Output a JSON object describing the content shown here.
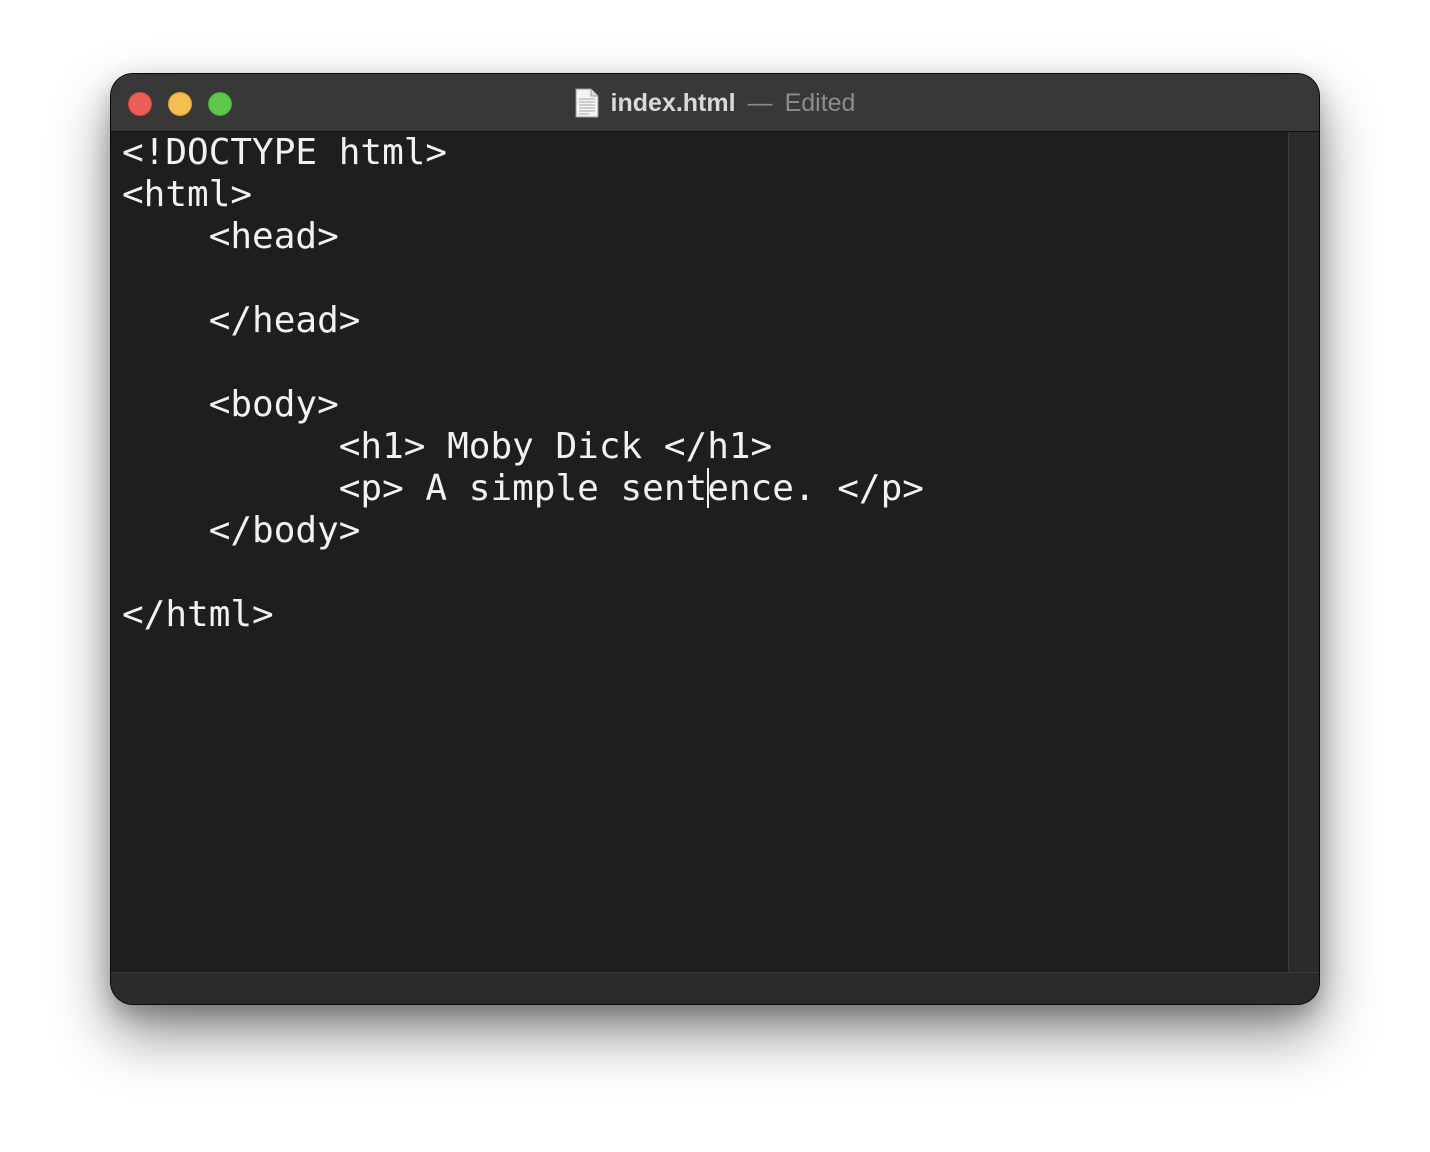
{
  "window": {
    "filename": "index.html",
    "separator": "—",
    "status": "Edited"
  },
  "editor": {
    "lines": [
      "<!DOCTYPE html>",
      "<html>",
      "    <head>",
      "",
      "    </head>",
      "",
      "    <body>",
      "          <h1> Moby Dick </h1>",
      "          <p> A simple sentence. </p>",
      "    </body>",
      "",
      "</html>"
    ],
    "cursor": {
      "line": 8,
      "column": 27
    }
  },
  "colors": {
    "close": "#ec5f57",
    "minimize": "#f4be50",
    "zoom": "#5ec54d",
    "editor_background": "#1e1e1e",
    "text": "#f2f2f2"
  }
}
